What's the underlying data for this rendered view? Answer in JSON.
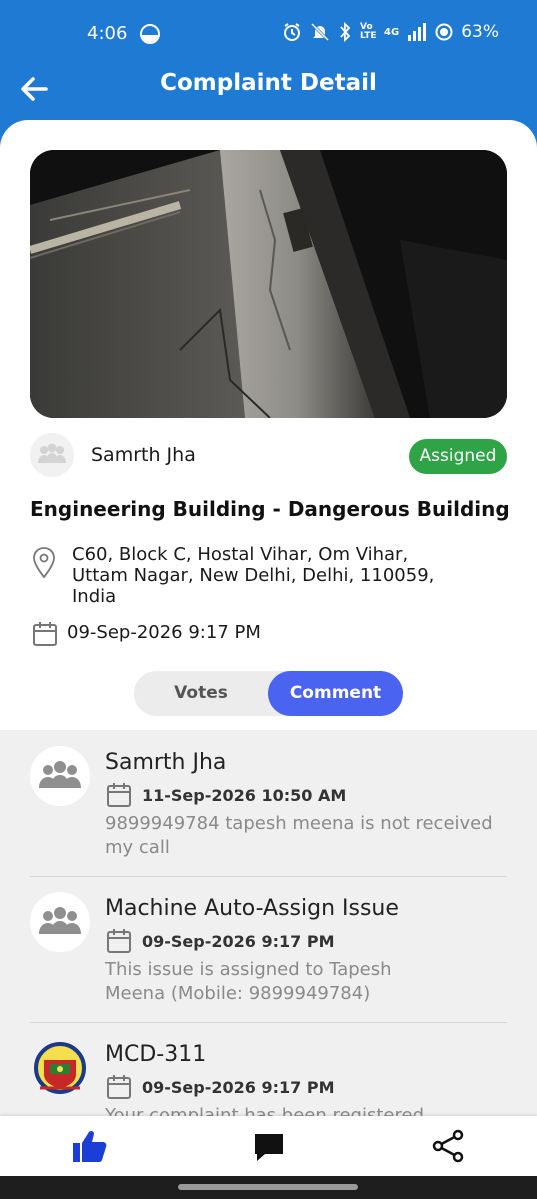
{
  "status_bar": {
    "time": "4:06",
    "volte": "Vo LTE",
    "network": "4G",
    "battery": "63%"
  },
  "app_bar": {
    "title": "Complaint Detail"
  },
  "complaint": {
    "reporter": "Samrth Jha",
    "status": "Assigned",
    "title": "Engineering Building - Dangerous Building",
    "address_line1": "C60, Block C, Hostal Vihar, Om Vihar,",
    "address_line2": "Uttam Nagar, New Delhi, Delhi, 110059,",
    "address_line3": "India",
    "date": "09-Sep-2026 9:17 PM"
  },
  "toggle": {
    "votes_label": "Votes",
    "comment_label": "Comment",
    "selected": "Comment"
  },
  "comments": [
    {
      "name": "Samrth Jha",
      "date": "11-Sep-2026 10:50 AM",
      "text_line1": "9899949784 tapesh meena is not received",
      "text_line2": "my call",
      "avatar": "people-icon"
    },
    {
      "name": "Machine Auto-Assign Issue",
      "date": "09-Sep-2026 9:17 PM",
      "text_line1": "This issue is assigned to Tapesh",
      "text_line2": "Meena (Mobile: 9899949784)",
      "avatar": "people-icon"
    },
    {
      "name": "MCD-311",
      "date": "09-Sep-2026 9:17 PM",
      "text_line1": "Your complaint has been registered",
      "avatar": "mcd-logo"
    }
  ],
  "colors": {
    "primary": "#1f7ad3",
    "accent": "#4a63f0",
    "assigned": "#2ea447",
    "nav_active": "#1b3fd6"
  },
  "bottom_nav": [
    "thumbs-up-icon",
    "comment-icon",
    "share-icon"
  ]
}
